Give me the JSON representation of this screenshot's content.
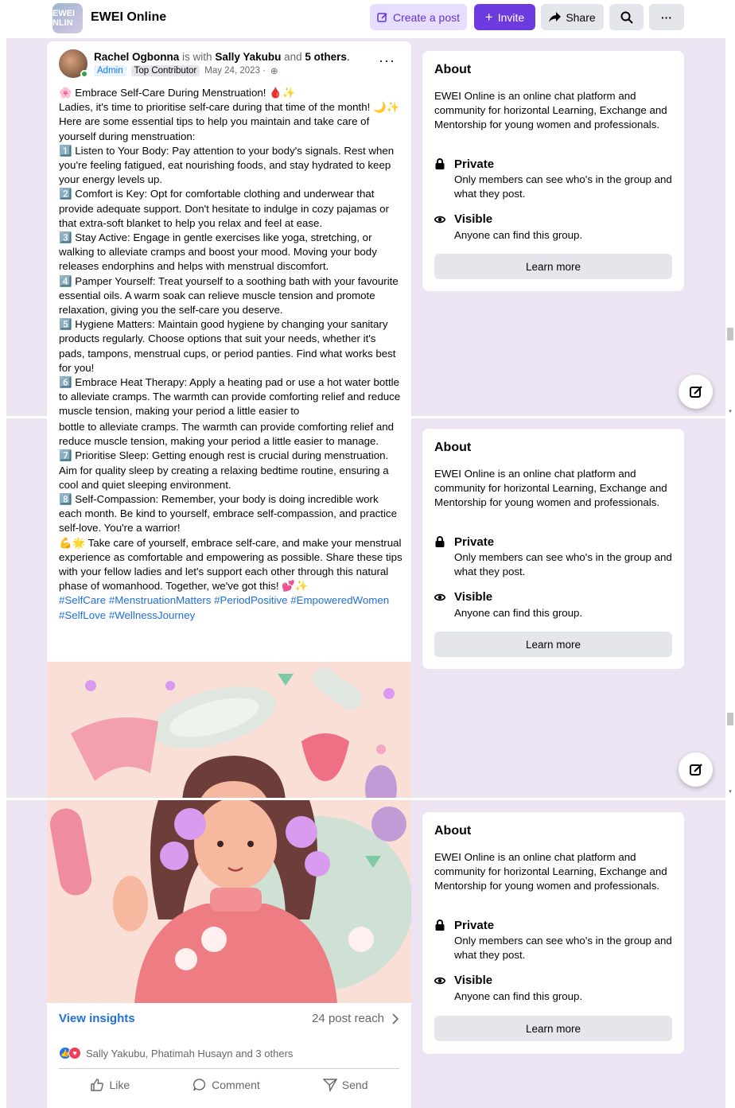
{
  "header": {
    "logo_text": "EWEI NLIN",
    "group_name": "EWEI Online",
    "create_post": "Create a post",
    "invite": "Invite",
    "share": "Share",
    "more": "···"
  },
  "post": {
    "author": "Rachel Ogbonna",
    "with_text": "is with",
    "with_person": "Sally Yakubu",
    "and_text": "and",
    "others": "5 others",
    "badge_admin": "Admin",
    "badge_top": "Top Contributor",
    "date": "May 24, 2023 ·",
    "menu": "···",
    "paragraphs_top": [
      "🌸 Embrace Self-Care During Menstruation! 🩸✨",
      "Ladies, it's time to prioritise self-care during that time of the month! 🌙✨ Here are some essential tips to help you maintain and take care of yourself during menstruation:",
      "1️⃣ Listen to Your Body: Pay attention to your body's signals. Rest when you're feeling fatigued, eat nourishing foods, and stay hydrated to keep your energy levels up.",
      "2️⃣ Comfort is Key: Opt for comfortable clothing and underwear that provide adequate support. Don't hesitate to indulge in cozy pajamas or that extra-soft blanket to help you relax and feel at ease.",
      "3️⃣ Stay Active: Engage in gentle exercises like yoga, stretching, or walking to alleviate cramps and boost your mood. Moving your body releases endorphins and helps with menstrual discomfort.",
      "4️⃣ Pamper Yourself: Treat yourself to a soothing bath with your favourite essential oils. A warm soak can relieve muscle tension and promote relaxation, giving you the self-care you deserve.",
      "5️⃣ Hygiene Matters: Maintain good hygiene by changing your sanitary products regularly. Choose options that suit your needs, whether it's pads, tampons, menstrual cups, or period panties. Find what works best for you!",
      "6️⃣ Embrace Heat Therapy: Apply a heating pad or use a hot water bottle to alleviate cramps. The warmth can provide comforting relief and reduce muscle tension, making your period a little easier to"
    ],
    "paragraphs_mid": [
      "bottle to alleviate cramps. The warmth can provide comforting relief and reduce muscle tension, making your period a little easier to manage.",
      "7️⃣ Prioritise Sleep: Getting enough rest is crucial during menstruation. Aim for quality sleep by creating a relaxing bedtime routine, ensuring a cool and quiet sleeping environment.",
      "8️⃣ Self-Compassion: Remember, your body is doing incredible work each month. Be kind to yourself, embrace self-compassion, and practice self-love. You're a warrior!",
      "💪🌟 Take care of yourself, embrace self-care, and make your menstrual experience as comfortable and empowering as possible. Share these tips with your fellow ladies and let's support each other through this natural phase of womanhood. Together, we've got this! 💕✨"
    ],
    "hashtags": "#SelfCare #MenstruationMatters #PeriodPositive #EmpoweredWomen #SelfLove #WellnessJourney",
    "view_insights": "View insights",
    "reach": "24 post reach",
    "reactions": "Sally Yakubu, Phatimah Husayn and 3 others",
    "like": "Like",
    "comment": "Comment",
    "send": "Send"
  },
  "about": {
    "title": "About",
    "description": "EWEI Online is an online chat platform and community for horizontal Learning, Exchange and Mentorship for young women and professionals.",
    "private_title": "Private",
    "private_sub": "Only members can see who's in the group and what they post.",
    "visible_title": "Visible",
    "visible_sub": "Anyone can find this group.",
    "learn_more": "Learn more"
  },
  "colors": {
    "accent": "#6c3be0",
    "link": "#216fdb",
    "background": "#ece4f3"
  }
}
